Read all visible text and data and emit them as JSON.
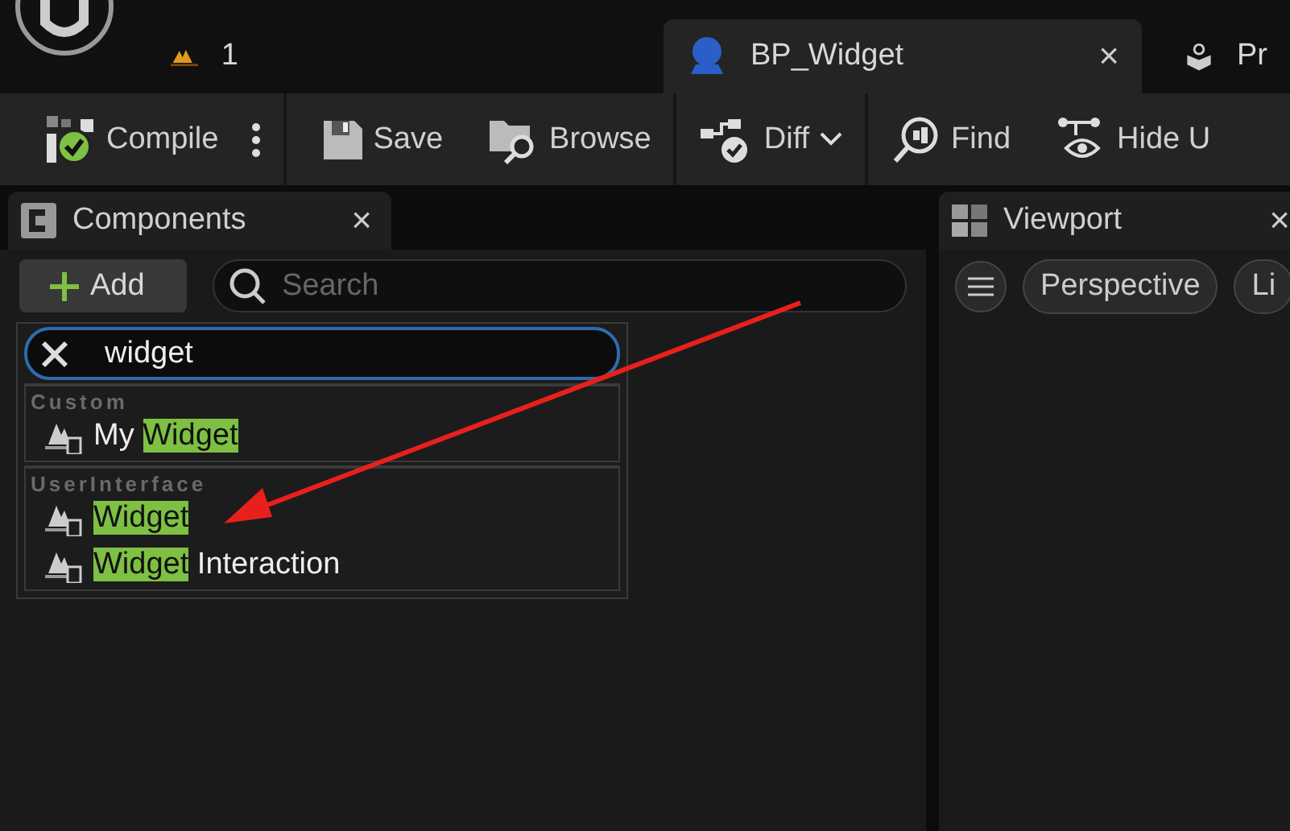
{
  "top_tabs": [
    {
      "kind": "warning",
      "label": "1",
      "selected": false
    },
    {
      "kind": "blueprint",
      "label": "BP_Widget",
      "selected": true,
      "close": "×"
    },
    {
      "kind": "project",
      "label": "Pr",
      "selected": false
    }
  ],
  "toolbar": [
    {
      "kind": "compile",
      "label": "Compile"
    },
    {
      "kind": "save",
      "label": "Save"
    },
    {
      "kind": "browse",
      "label": "Browse"
    },
    {
      "kind": "diff",
      "label": "Diff"
    },
    {
      "kind": "find",
      "label": "Find"
    },
    {
      "kind": "hide",
      "label": "Hide U"
    }
  ],
  "components_panel": {
    "title": "Components",
    "close": "×",
    "add_button": "Add",
    "search": {
      "placeholder": "Search"
    }
  },
  "add_menu": {
    "filter": "widget",
    "groups": [
      {
        "name": "Custom",
        "items": [
          {
            "segments": [
              {
                "text": "My ",
                "highlight": false
              },
              {
                "text": "Widget",
                "highlight": true
              }
            ]
          }
        ]
      },
      {
        "name": "UserInterface",
        "items": [
          {
            "segments": [
              {
                "text": "Widget",
                "highlight": true
              }
            ]
          },
          {
            "segments": [
              {
                "text": "Widget",
                "highlight": true
              },
              {
                "text": " Interaction",
                "highlight": false
              }
            ]
          }
        ]
      }
    ]
  },
  "viewport_panel": {
    "title": "Viewport",
    "close": "×",
    "buttons": [
      "Perspective",
      "Li"
    ]
  }
}
